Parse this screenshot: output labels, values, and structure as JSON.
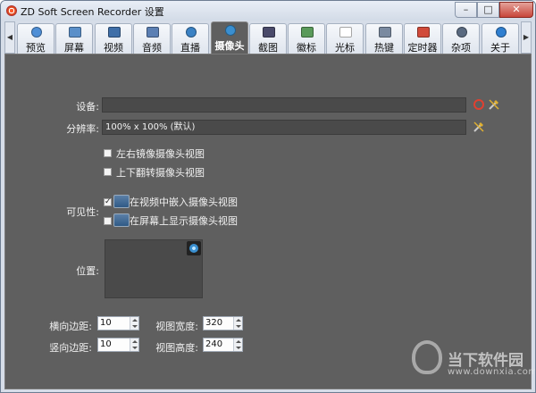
{
  "window": {
    "title": "ZD Soft Screen Recorder 设置",
    "minimize_symbol": "–",
    "maximize_symbol": "□",
    "close_symbol": "✕"
  },
  "tabstrip": {
    "left_arrow": "◀",
    "right_arrow": "▶",
    "tabs": [
      {
        "label": "预览",
        "icon": "eye-icon",
        "color": "#4f8fd6"
      },
      {
        "label": "屏幕",
        "icon": "monitor-icon",
        "color": "#5a8fc9"
      },
      {
        "label": "视频",
        "icon": "film-icon",
        "color": "#3f6fa8"
      },
      {
        "label": "音频",
        "icon": "music-icon",
        "color": "#5b7fb3"
      },
      {
        "label": "直播",
        "icon": "broadcast-icon",
        "color": "#3b82c4"
      },
      {
        "label": "摄像头",
        "icon": "webcam-icon",
        "color": "#3a8fd0",
        "active": true
      },
      {
        "label": "截图",
        "icon": "camera-icon",
        "color": "#4a4a6a"
      },
      {
        "label": "徽标",
        "icon": "image-icon",
        "color": "#5a9a5a"
      },
      {
        "label": "光标",
        "icon": "cursor-icon",
        "color": "#ffffff"
      },
      {
        "label": "热键",
        "icon": "keyboard-icon",
        "color": "#7a8aa0"
      },
      {
        "label": "定时器",
        "icon": "alarm-clock-icon",
        "color": "#d04a3a"
      },
      {
        "label": "杂项",
        "icon": "gear-icon",
        "color": "#5a6a80"
      },
      {
        "label": "关于",
        "icon": "info-icon",
        "color": "#2f7fd0"
      }
    ]
  },
  "camera": {
    "device_label": "设备:",
    "device_value": "",
    "resolution_label": "分辨率:",
    "resolution_value": "100% x 100% (默认)",
    "mirror_h_label": "左右镜像摄像头视图",
    "mirror_h_checked": false,
    "flip_v_label": "上下翻转摄像头视图",
    "flip_v_checked": false,
    "visibility_label": "可见性:",
    "embed_in_video_label": "在视频中嵌入摄像头视图",
    "embed_in_video_checked": true,
    "show_on_screen_label": "在屏幕上显示摄像头视图",
    "show_on_screen_checked": false,
    "position_label": "位置:",
    "h_margin_label": "横向边距:",
    "h_margin_value": "10",
    "v_margin_label": "竖向边距:",
    "v_margin_value": "10",
    "view_width_label": "视图宽度:",
    "view_width_value": "320",
    "view_height_label": "视图高度:",
    "view_height_value": "240",
    "check_mark": "✓"
  },
  "watermark": {
    "text": "当下软件园",
    "url": "www.downxia.com"
  }
}
